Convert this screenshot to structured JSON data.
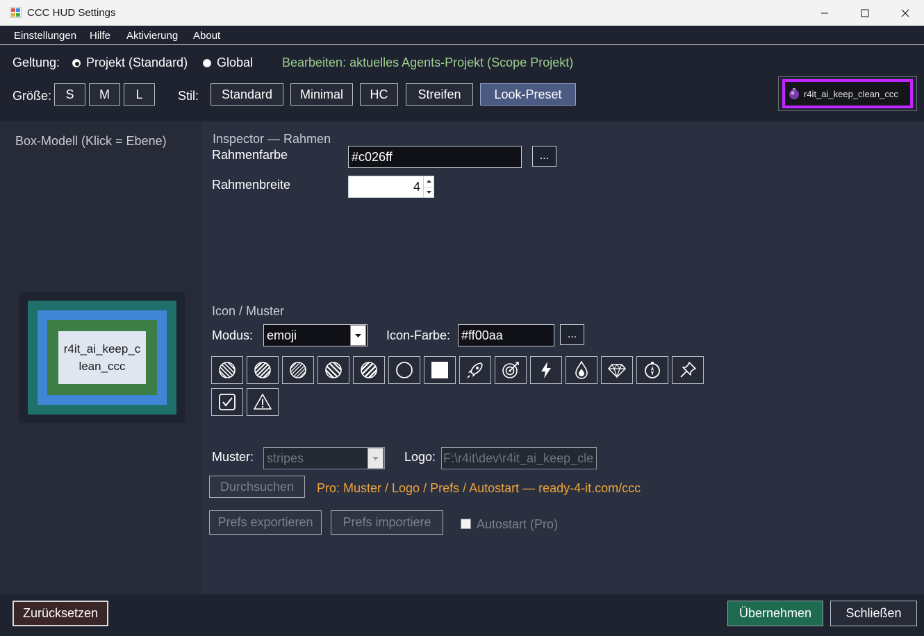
{
  "window": {
    "title": "CCC HUD Settings"
  },
  "menu": {
    "items": [
      "Einstellungen",
      "Hilfe",
      "Aktivierung",
      "About"
    ]
  },
  "scope": {
    "label": "Geltung:",
    "option_project": "Projekt (Standard)",
    "option_global": "Global",
    "selected": "project",
    "status": "Bearbeiten: aktuelles Agents-Projekt (Scope Projekt)"
  },
  "size": {
    "label": "Größe:",
    "buttons": [
      "S",
      "M",
      "L"
    ]
  },
  "style": {
    "label": "Stil:",
    "buttons": [
      "Standard",
      "Minimal",
      "HC",
      "Streifen",
      "Look-Preset"
    ],
    "active": "Look-Preset"
  },
  "preview_badge": {
    "label": "r4it_ai_keep_clean_ccc",
    "border_color": "#c026ff"
  },
  "box_model": {
    "title": "Box-Modell (Klick = Ebene)",
    "content_text": "r4it_ai_keep_c\nlean_ccc",
    "colors": {
      "outer": "#1f6f6a",
      "blue": "#3f86d6",
      "green": "#3d7d46",
      "content": "#dfe6f0"
    }
  },
  "inspector": {
    "title": "Inspector — Rahmen",
    "color_label": "Rahmenfarbe",
    "color_value": "#c026ff",
    "width_label": "Rahmenbreite",
    "width_value": "4",
    "more_label": "..."
  },
  "icon": {
    "title": "Icon / Muster",
    "mode_label": "Modus:",
    "mode_value": "emoji",
    "color_label": "Icon-Farbe:",
    "color_value": "#ff00aa",
    "more_label": "...",
    "glyphs": [
      "pattern-stripes-icon",
      "pattern-diagonal-icon",
      "pattern-diagonal-dense-icon",
      "pattern-stripes-reverse-icon",
      "pattern-diagonal-wide-icon",
      "circle-icon",
      "square-icon",
      "rocket-icon",
      "target-icon",
      "lightning-icon",
      "drop-icon",
      "diamond-icon",
      "compass-icon",
      "pin-icon",
      "checkbox-icon",
      "warning-icon"
    ]
  },
  "pattern": {
    "label": "Muster:",
    "value": "stripes"
  },
  "logo": {
    "label": "Logo:",
    "value": "F:\\r4it\\dev\\r4it_ai_keep_cle"
  },
  "browse_label": "Durchsuchen",
  "pro_note": "Pro: Muster / Logo / Prefs / Autostart — ready-4-it.com/ccc",
  "prefs": {
    "export_label": "Prefs exportieren",
    "import_label": "Prefs importiere"
  },
  "autostart": {
    "label": "Autostart (Pro)",
    "checked": false
  },
  "footer": {
    "reset_label": "Zurücksetzen",
    "apply_label": "Übernehmen",
    "close_label": "Schließen"
  },
  "colors": {
    "accent_green": "#9ccf8f",
    "pro_orange": "#f0a53c",
    "apply_bg": "#1f6b4f",
    "reset_bg": "#3a2626"
  }
}
